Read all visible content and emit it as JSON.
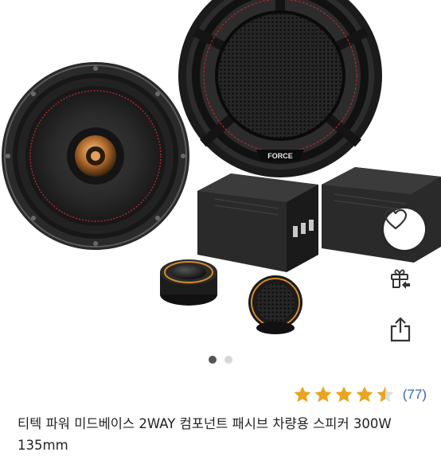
{
  "product": {
    "title": "티텍 파워 미드베이스 2WAY 컴포넌트 패시브 차량용 스피커 300W 135mm",
    "rating_count": "(77)",
    "rating_value": 4.5,
    "rating_max": 5,
    "image_brand_text": "FORCE"
  },
  "gallery": {
    "total": 2,
    "active_index": 0
  },
  "actions": {
    "wishlist_icon": "heart-outline-icon",
    "gift_icon": "gift-share-icon",
    "share_icon": "share-upload-icon"
  },
  "colors": {
    "star": "#e9a520",
    "rating_count": "#3a66b8",
    "accent_speaker_ring": "#b3282e",
    "tweeter_trim": "#d58a2a"
  }
}
